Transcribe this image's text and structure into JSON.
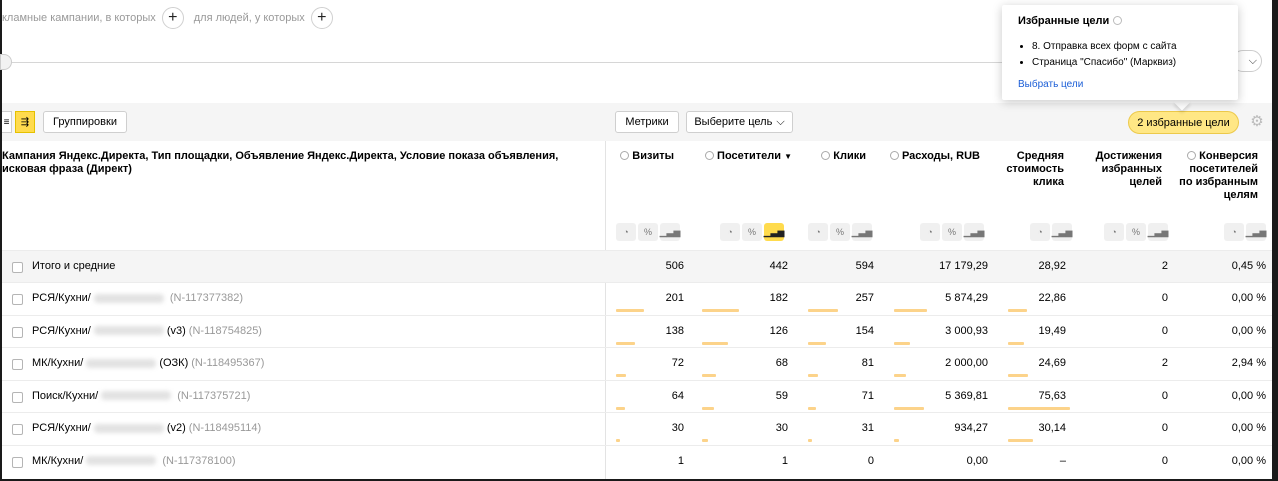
{
  "segments": {
    "text_left": "кламные кампании, в которых",
    "text_mid": "для людей, у которых"
  },
  "toolbar": {
    "groupings": "Группировки",
    "metrics": "Метрики",
    "choose_goal": "Выберите цель",
    "fav_goals_pill": "2 избранные цели"
  },
  "popup": {
    "title": "Избранные цели",
    "goals": [
      "8. Отправка всех форм с сайта",
      "Страница \"Спасибо\" (Марквиз)"
    ],
    "link": "Выбрать цели"
  },
  "table": {
    "dimension_header": "Кампания Яндекс.Директа, Тип площадки, Объявление Яндекс.Директа, Условие показа объявления, исковая фраза (Директ)",
    "columns": [
      {
        "key": "visits",
        "label": "Визиты"
      },
      {
        "key": "visitors",
        "label": "Посетители",
        "sort": "▼"
      },
      {
        "key": "clicks",
        "label": "Клики"
      },
      {
        "key": "cost",
        "label": "Расходы, RUB"
      },
      {
        "key": "cpc",
        "label": "Средняя стоимость клика"
      },
      {
        "key": "goals",
        "label": "Достижения избранных целей"
      },
      {
        "key": "conv",
        "label": "Конверсия посетителей по избранным целям"
      }
    ],
    "total": {
      "name": "Итого и средние",
      "values": [
        "506",
        "442",
        "594",
        "17 179,29",
        "28,92",
        "2",
        "0,45 %"
      ]
    },
    "rows": [
      {
        "prefix": "РСЯ/Кухни/",
        "suffix": "",
        "id": "(N-117377382)",
        "values": [
          "201",
          "182",
          "257",
          "5 874,29",
          "22,86",
          "0",
          "0,00 %"
        ],
        "bars": [
          0.4,
          0.41,
          0.43,
          0.34,
          0.3
        ]
      },
      {
        "prefix": "РСЯ/Кухни/",
        "suffix": "(v3)",
        "id": "(N-118754825)",
        "values": [
          "138",
          "126",
          "154",
          "3 000,93",
          "19,49",
          "0",
          "0,00 %"
        ],
        "bars": [
          0.27,
          0.29,
          0.26,
          0.17,
          0.26
        ]
      },
      {
        "prefix": "МК/Кухни/",
        "suffix": "(ОЗК)",
        "id": "(N-118495367)",
        "values": [
          "72",
          "68",
          "81",
          "2 000,00",
          "24,69",
          "2",
          "2,94 %"
        ],
        "bars": [
          0.14,
          0.15,
          0.14,
          0.12,
          0.33
        ]
      },
      {
        "prefix": "Поиск/Кухни/",
        "suffix": "",
        "id": "(N-117375721)",
        "values": [
          "64",
          "59",
          "71",
          "5 369,81",
          "75,63",
          "0",
          "0,00 %"
        ],
        "bars": [
          0.13,
          0.13,
          0.12,
          0.31,
          1.0
        ]
      },
      {
        "prefix": "РСЯ/Кухни/",
        "suffix": "(v2)",
        "id": "(N-118495114)",
        "values": [
          "30",
          "30",
          "31",
          "934,27",
          "30,14",
          "0",
          "0,00 %"
        ],
        "bars": [
          0.06,
          0.07,
          0.05,
          0.05,
          0.4
        ]
      },
      {
        "prefix": "МК/Кухни/",
        "suffix": "",
        "id": "(N-117378100)",
        "values": [
          "1",
          "1",
          "0",
          "0,00",
          "–",
          "0",
          "0,00 %"
        ],
        "bars": [
          0.0,
          0.0,
          0.0,
          0.0,
          0.0
        ]
      }
    ]
  },
  "colors": {
    "accent_yellow": "#ffdb4d",
    "pill_yellow": "#ffe785",
    "bar_orange": "#fcd38a",
    "link_blue": "#1a5dd6"
  }
}
